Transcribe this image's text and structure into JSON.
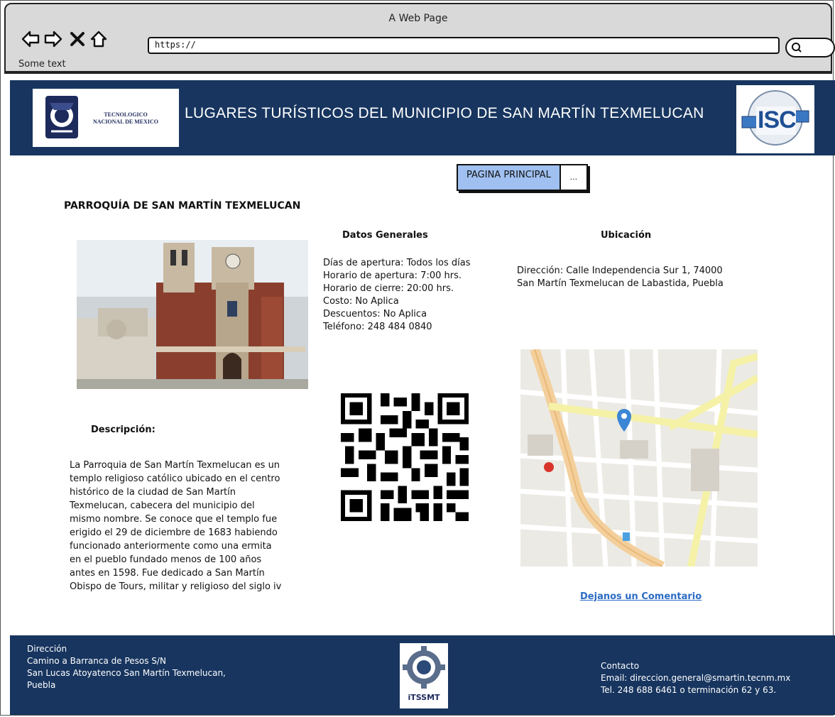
{
  "browser": {
    "window_title": "A Web Page",
    "url": "https://",
    "status_text": "Some text"
  },
  "header": {
    "logo_left_text_1": "TECNOLOGICO",
    "logo_left_text_2": "NACIONAL DE MEXICO",
    "title": "LUGARES TURÍSTICOS DEL MUNICIPIO DE SAN MARTÍN TEXMELUCAN",
    "logo_right_text": "ISC"
  },
  "nav": {
    "main_label": "PAGINA PRINCIPAL",
    "more_label": "..."
  },
  "place": {
    "title": "PARROQUÍA DE SAN MARTÍN TEXMELUCAN"
  },
  "datos": {
    "heading": "Datos Generales",
    "lines": [
      "Días de apertura: Todos los días",
      "Horario de apertura: 7:00 hrs.",
      "Horario de  cierre: 20:00 hrs.",
      "Costo: No Aplica",
      "Descuentos: No Aplica",
      "Teléfono: 248 484 0840"
    ]
  },
  "ubicacion": {
    "heading": "Ubicación",
    "lines": [
      "Dirección: Calle Independencia Sur 1, 74000",
      "San Martín Texmelucan de Labastida, Puebla"
    ]
  },
  "descripcion": {
    "heading": "Descripción:",
    "lines": [
      "La Parroquia de San Martín Texmelucan es un",
      "templo religioso católico ubicado en el centro",
      "histórico de la ciudad de San Martín",
      "Texmelucan, cabecera del municipio del",
      "mismo nombre. Se conoce que el templo fue",
      "erigido el 29 de diciembre de 1683 habiendo",
      "funcionado anteriormente como una ermita",
      "en el pueblo fundado menos de 100 años",
      "antes en 1598. Fue dedicado a San Martín",
      "Obispo de Tours, militar y religioso del siglo iv"
    ]
  },
  "comment_link": "Dejanos un Comentario",
  "footer": {
    "left_lines": [
      "Dirección",
      "Camino a Barranca de Pesos S/N",
      "San Lucas Atoyatenco San Martín Texmelucan,",
      "Puebla"
    ],
    "logo_text": "iTSSMT",
    "right_lines": [
      "Contacto",
      "Email: direccion.general@smartin.tecnm.mx",
      "Tel. 248 688 6461 o terminación 62 y 63."
    ]
  },
  "colors": {
    "header_bg": "#17355f",
    "nav_button": "#9fc0f0",
    "link": "#2b6cc4"
  },
  "icons": [
    "back-arrow-icon",
    "forward-arrow-icon",
    "close-icon",
    "home-icon",
    "search-icon",
    "map-pin-icon",
    "qr-code"
  ]
}
